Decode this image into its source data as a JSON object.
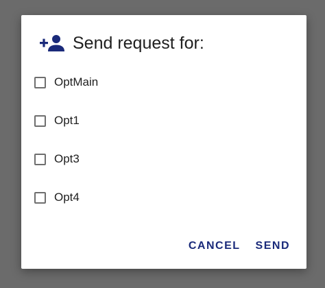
{
  "dialog": {
    "title": "Send request for:",
    "icon": "person-add-icon",
    "accent_color": "#1a2a7a",
    "options": [
      {
        "label": "OptMain",
        "checked": false
      },
      {
        "label": "Opt1",
        "checked": false
      },
      {
        "label": "Opt3",
        "checked": false
      },
      {
        "label": "Opt4",
        "checked": false
      }
    ],
    "actions": {
      "cancel_label": "CANCEL",
      "send_label": "SEND"
    }
  }
}
